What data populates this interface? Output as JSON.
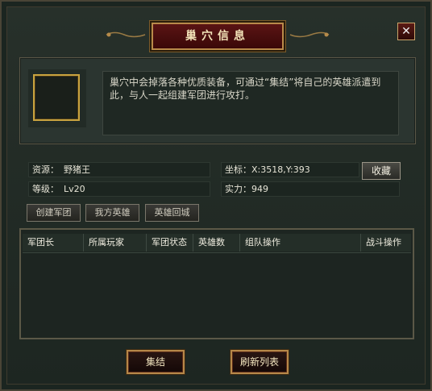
{
  "window": {
    "title": "巢穴信息",
    "close_symbol": "✕"
  },
  "description": "巢穴中会掉落各种优质装备，可通过“集结”将自己的英雄派遣到此，与人一起组建军团进行攻打。",
  "info": {
    "resource_label": "资源：",
    "resource_value": "野猪王",
    "level_label": "等级：",
    "level_value": "Lv20",
    "coord_label": "坐标：",
    "coord_value": "X:3518,Y:393",
    "strength_label": "实力：",
    "strength_value": "949",
    "favorite_button": "收藏"
  },
  "actions": {
    "create_legion": "创建军团",
    "my_heroes": "我方英雄",
    "recall_heroes": "英雄回城"
  },
  "table": {
    "columns": [
      "军团长",
      "所属玩家",
      "军团状态",
      "英雄数",
      "组队操作",
      "战斗操作"
    ],
    "rows": []
  },
  "footer": {
    "rally_button": "集结",
    "refresh_button": "刷新列表"
  },
  "colors": {
    "gold_frame": "#c9a33f",
    "title_red": "#3a0808",
    "panel_bg": "#1b2520"
  }
}
